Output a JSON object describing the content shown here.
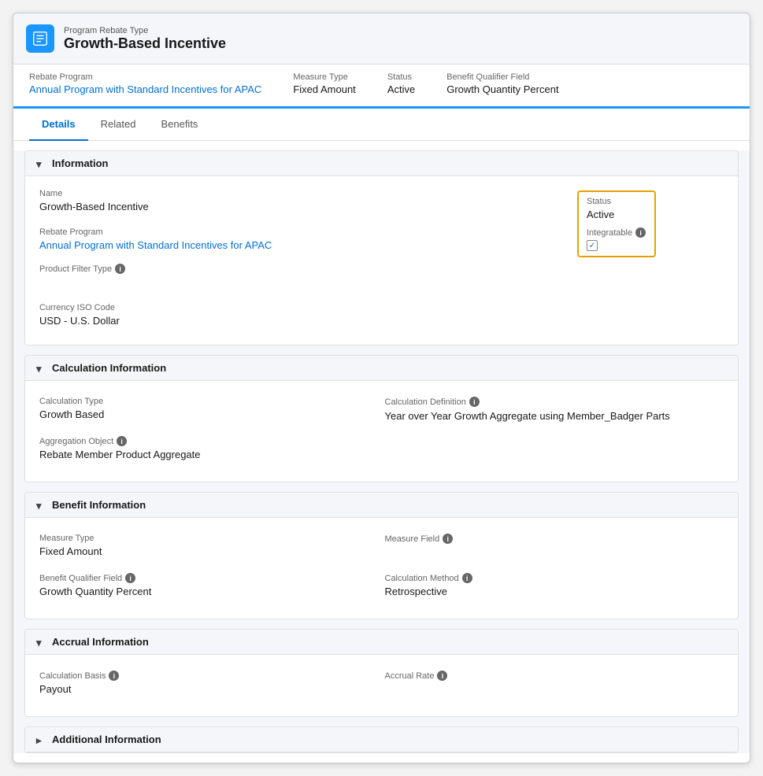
{
  "header": {
    "subtitle": "Program Rebate Type",
    "title": "Growth-Based Incentive",
    "icon_label": "rebate-icon"
  },
  "meta_bar": {
    "rebate_program_label": "Rebate Program",
    "rebate_program_value": "Annual Program with Standard Incentives for APAC",
    "measure_type_label": "Measure Type",
    "measure_type_value": "Fixed Amount",
    "status_label": "Status",
    "status_value": "Active",
    "benefit_qualifier_label": "Benefit Qualifier Field",
    "benefit_qualifier_value": "Growth Quantity Percent"
  },
  "tabs": [
    {
      "label": "Details",
      "active": true
    },
    {
      "label": "Related",
      "active": false
    },
    {
      "label": "Benefits",
      "active": false
    }
  ],
  "sections": {
    "information": {
      "title": "Information",
      "name_label": "Name",
      "name_value": "Growth-Based Incentive",
      "rebate_program_label": "Rebate Program",
      "rebate_program_value": "Annual Program with Standard Incentives for APAC",
      "product_filter_label": "Product Filter Type",
      "product_filter_value": "",
      "currency_label": "Currency ISO Code",
      "currency_value": "USD - U.S. Dollar",
      "status_label": "Status",
      "status_value": "Active",
      "integratable_label": "Integratable",
      "integratable_checked": true
    },
    "calculation": {
      "title": "Calculation Information",
      "calc_type_label": "Calculation Type",
      "calc_type_value": "Growth Based",
      "calc_def_label": "Calculation Definition",
      "calc_def_value": "Year over Year Growth Aggregate using Member_Badger Parts",
      "agg_object_label": "Aggregation Object",
      "agg_object_value": "Rebate Member Product Aggregate"
    },
    "benefit": {
      "title": "Benefit Information",
      "measure_type_label": "Measure Type",
      "measure_type_value": "Fixed Amount",
      "measure_field_label": "Measure Field",
      "measure_field_value": "",
      "benefit_qualifier_label": "Benefit Qualifier Field",
      "benefit_qualifier_value": "Growth Quantity Percent",
      "calc_method_label": "Calculation Method",
      "calc_method_value": "Retrospective"
    },
    "accrual": {
      "title": "Accrual Information",
      "calc_basis_label": "Calculation Basis",
      "calc_basis_value": "Payout",
      "accrual_rate_label": "Accrual Rate",
      "accrual_rate_value": ""
    },
    "additional": {
      "title": "Additional Information"
    }
  },
  "icons": {
    "edit_pencil": "✏",
    "chevron_down": "▾",
    "chevron_right": "▸",
    "info": "i",
    "check": "✓"
  }
}
